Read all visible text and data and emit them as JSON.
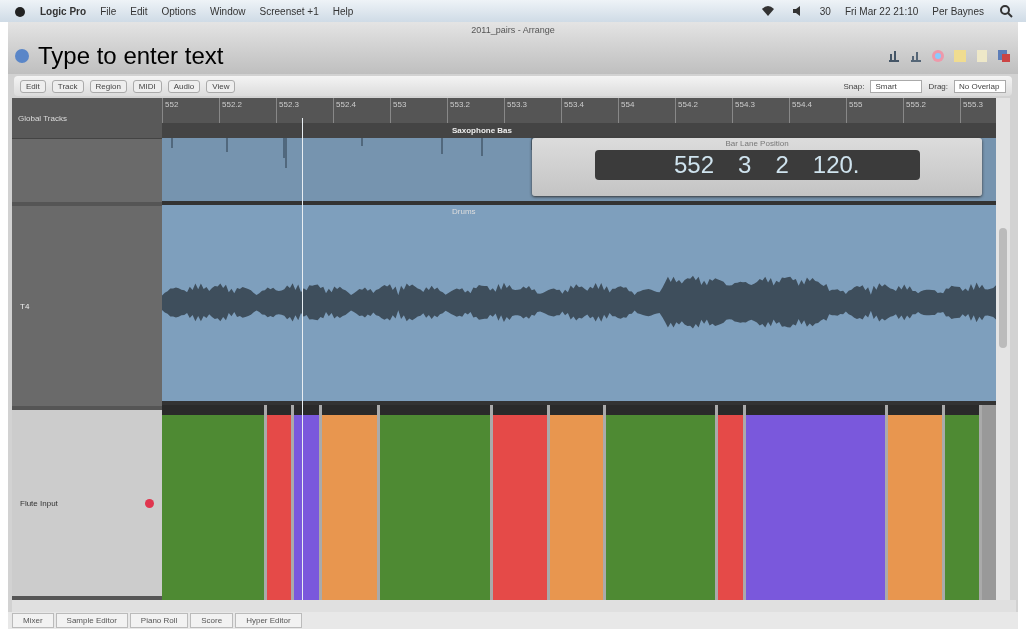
{
  "menu_bar": {
    "items": [
      "Logic Pro",
      "File",
      "Edit",
      "Options",
      "Window",
      "Screenset +1",
      "Help"
    ],
    "status": [
      "30",
      "Fri Mar 22  21:10",
      "Per Baynes"
    ]
  },
  "window": {
    "title": "2011_pairs - Arrange"
  },
  "annotation": "Type to enter text",
  "toolbar": {
    "menus": [
      "Edit",
      "Track",
      "Region",
      "MIDI",
      "Audio",
      "View"
    ],
    "snap_label": "Snap:",
    "snap_value": "Smart",
    "drag_label": "Drag:",
    "drag_value": "No Overlap"
  },
  "ruler": [
    "552",
    "552.2",
    "552.3",
    "552.4",
    "553",
    "553.2",
    "553.3",
    "553.4",
    "554",
    "554.2",
    "554.3",
    "554.4",
    "555",
    "555.2",
    "555.3"
  ],
  "global_tracks": {
    "label": "Global Tracks",
    "marker": "Saxophone Bas"
  },
  "position_window": {
    "title": "Bar Lane Position",
    "digits": [
      "552",
      "3",
      "2",
      "120."
    ]
  },
  "tracks": [
    {
      "kind": "spikes",
      "armed": false
    },
    {
      "kind": "waveform",
      "name": "T4",
      "armed": false,
      "region": "Drums"
    },
    {
      "kind": "chords",
      "name": "Flute Input",
      "armed": true,
      "regions": [
        {
          "color": "#4e8a33"
        },
        {
          "color": "#e54a48"
        },
        {
          "color": "#7a58dc"
        },
        {
          "color": "#e8964f"
        },
        {
          "color": "#4e8a33"
        },
        {
          "color": "#e54a48"
        },
        {
          "color": "#e8964f"
        },
        {
          "color": "#4e8a33"
        },
        {
          "color": "#e54a48"
        },
        {
          "color": "#7a58dc"
        },
        {
          "color": "#e8964f"
        },
        {
          "color": "#4e8a33"
        }
      ]
    }
  ],
  "bottom_tabs": [
    "Mixer",
    "Sample Editor",
    "Piano Roll",
    "Score",
    "Hyper Editor"
  ]
}
